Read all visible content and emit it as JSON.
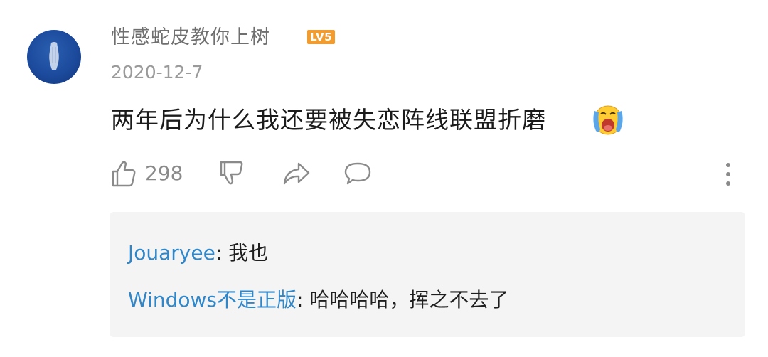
{
  "comment": {
    "username": "性感蛇皮教你上树",
    "level": "LV5",
    "date": "2020-12-7",
    "text": "两年后为什么我还要被失恋阵线联盟折磨",
    "emoji": "crying-face-icon",
    "likes": "298"
  },
  "actions": {
    "like_icon": "thumbs-up-icon",
    "dislike_icon": "thumbs-down-icon",
    "share_icon": "share-icon",
    "reply_icon": "speech-bubble-icon",
    "more_icon": "vertical-ellipsis-icon"
  },
  "replies": [
    {
      "author": "Jouaryee",
      "separator": ": ",
      "text": "我也"
    },
    {
      "author": "Windows不是正版",
      "separator": ": ",
      "text": "哈哈哈哈，挥之不去了"
    }
  ],
  "colors": {
    "reply_author": "#2f86c8",
    "badge": "#f29b2e",
    "reply_background": "#f4f4f4",
    "avatar": "#1c4a9c"
  }
}
